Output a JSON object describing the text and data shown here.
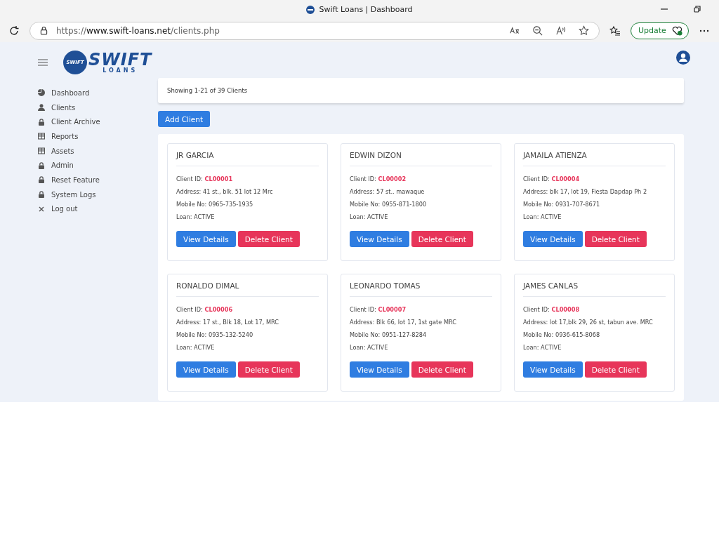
{
  "window": {
    "title": "Swift Loans | Dashboard"
  },
  "address_bar": {
    "url": "https://**www.swift-loans.net**/clients.php",
    "update_label": "Update"
  },
  "logo": {
    "badge": "SWIFT",
    "name": "SWIFT",
    "tagline": "LOANS"
  },
  "sidebar": {
    "items": [
      {
        "label": "Dashboard",
        "kind": "pie"
      },
      {
        "label": "Clients",
        "kind": "user"
      },
      {
        "label": "Client Archive",
        "kind": "lock"
      },
      {
        "label": "Reports",
        "kind": "table"
      },
      {
        "label": "Assets",
        "kind": "table"
      },
      {
        "label": "Admin",
        "kind": "lock"
      },
      {
        "label": "Reset Feature",
        "kind": "lock"
      },
      {
        "label": "System Logs",
        "kind": "lock"
      },
      {
        "label": "Log out",
        "kind": "close"
      }
    ]
  },
  "summary": "Showing 1-21 of 39 Clients",
  "add_button": "Add Client",
  "clients": [
    {
      "name": "JR GARCIA",
      "id_label": "Client ID:",
      "id": "CL00001",
      "address": "Address: 41 st., blk. 51 lot 12 Mrc",
      "mobile": "Mobile No: 0965-735-1935",
      "loan": "Loan: ACTIVE",
      "view": "View Details",
      "delete": "Delete Client"
    },
    {
      "name": "EDWIN DIZON",
      "id_label": "Client ID:",
      "id": "CL00002",
      "address": "Address: 57 st.. mawaque",
      "mobile": "Mobile No: 0955-871-1800",
      "loan": "Loan: ACTIVE",
      "view": "View Details",
      "delete": "Delete Client"
    },
    {
      "name": "JAMAILA ATIENZA",
      "id_label": "Client ID:",
      "id": "CL00004",
      "address": "Address: blk 17, lot 19, Fiesta Dapdap Ph 2",
      "mobile": "Mobile No: 0931-707-8671",
      "loan": "Loan: ACTIVE",
      "view": "View Details",
      "delete": "Delete Client"
    },
    {
      "name": "RONALDO DIMAL",
      "id_label": "Client ID:",
      "id": "CL00006",
      "address": "Address: 17 st., Blk 18, Lot 17, MRC",
      "mobile": "Mobile No: 0935-132-5240",
      "loan": "Loan: ACTIVE",
      "view": "View Details",
      "delete": "Delete Client"
    },
    {
      "name": "LEONARDO TOMAS",
      "id_label": "Client ID:",
      "id": "CL00007",
      "address": "Address: Blk 66, lot 17, 1st gate MRC",
      "mobile": "Mobile No: 0951-127-8284",
      "loan": "Loan: ACTIVE",
      "view": "View Details",
      "delete": "Delete Client"
    },
    {
      "name": "JAMES CANLAS",
      "id_label": "Client ID:",
      "id": "CL00008",
      "address": "Address: lot 17,blk 29, 26 st, tabun ave. MRC",
      "mobile": "Mobile No: 0936-615-8068",
      "loan": "Loan: ACTIVE",
      "view": "View Details",
      "delete": "Delete Client"
    }
  ]
}
